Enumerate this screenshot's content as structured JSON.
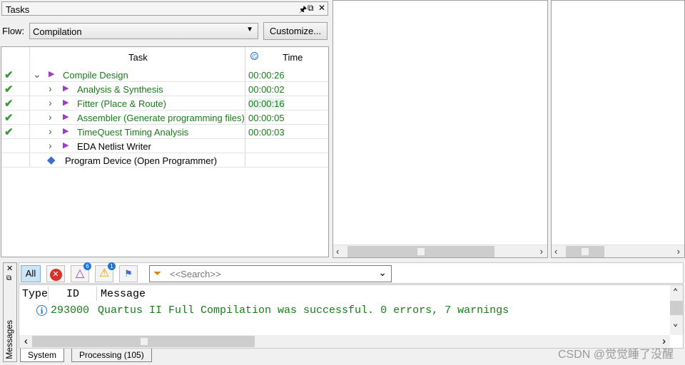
{
  "tasks_panel": {
    "title": "Tasks",
    "controls": [
      "⊓",
      "⧉",
      "✕"
    ],
    "flow_label": "Flow:",
    "flow_value": "Compilation",
    "customize_label": "Customize...",
    "col_task": "Task",
    "col_time": "Time",
    "rows": [
      {
        "label": "Compile Design",
        "time": "00:00:26",
        "done": true
      },
      {
        "label": "Analysis & Synthesis",
        "time": "00:00:02",
        "done": true
      },
      {
        "label": "Fitter (Place & Route)",
        "time": "00:00:16",
        "done": true
      },
      {
        "label": "Assembler (Generate programming files)",
        "time": "00:00:05",
        "done": true
      },
      {
        "label": "TimeQuest Timing Analysis",
        "time": "00:00:03",
        "done": true
      },
      {
        "label": "EDA Netlist Writer",
        "time": "",
        "done": false
      },
      {
        "label": "Program Device (Open Programmer)",
        "time": "",
        "done": false
      }
    ]
  },
  "messages": {
    "side_label": "Messages",
    "all_label": "All",
    "badge_critical": "6",
    "badge_warning": "1",
    "search_placeholder": "<<Search>>",
    "col_type": "Type",
    "col_id": "ID",
    "col_message": "Message",
    "row_id": "293000",
    "row_text": "Quartus II Full Compilation was successful. 0 errors, 7 warnings",
    "tabs": [
      "System",
      "Processing (105)"
    ]
  },
  "watermark": "CSDN @觉觉睡了没醒",
  "colors": {
    "success_green": "#1a7a1a",
    "run_purple": "#9a3fbf",
    "info_blue": "#1e72d8"
  }
}
